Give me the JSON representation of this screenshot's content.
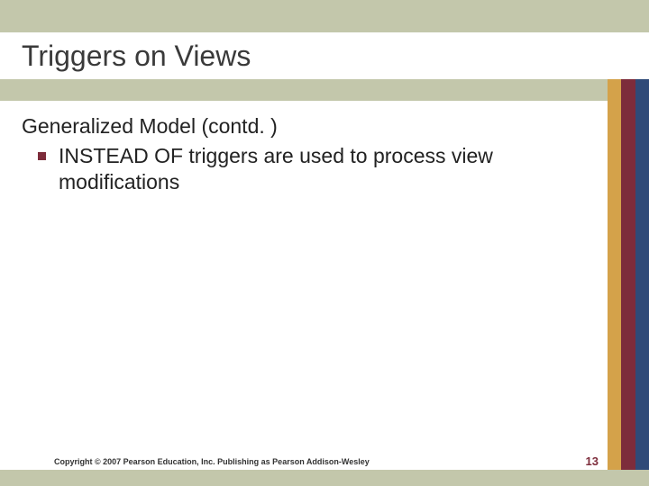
{
  "title": "Triggers on Views",
  "content": {
    "subhead": "Generalized Model (contd. )",
    "bullets": [
      {
        "text": "INSTEAD OF triggers are used to process view modifications"
      }
    ]
  },
  "footer": {
    "copyright": "Copyright © 2007 Pearson Education, Inc. Publishing as Pearson Addison-Wesley",
    "page_number": "13"
  },
  "theme": {
    "band_color": "#c3c7ab",
    "accent_mustard": "#d4a24a",
    "accent_maroon": "#7d2c3b",
    "accent_blue": "#2f4a78"
  }
}
